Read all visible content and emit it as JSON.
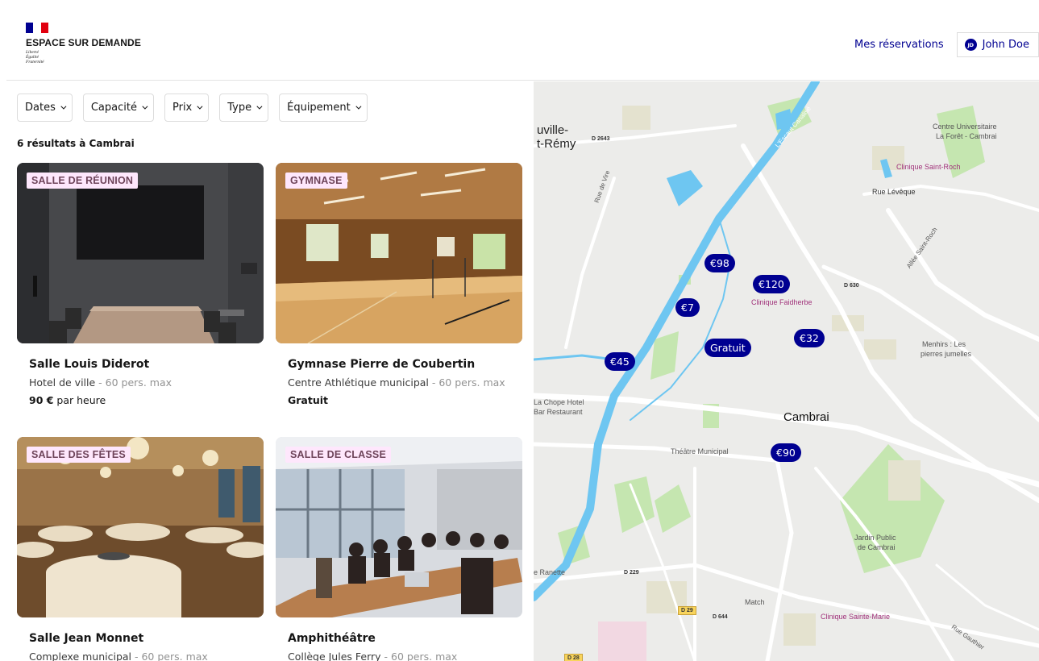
{
  "header": {
    "brand_title": "ESPACE SUR DEMANDE",
    "motto": [
      "Liberté",
      "Égalité",
      "Fraternité"
    ],
    "nav_reservations": "Mes réservations",
    "user_initials": "JD",
    "user_name": "John Doe"
  },
  "filters": [
    {
      "label": "Dates"
    },
    {
      "label": "Capacité"
    },
    {
      "label": "Prix"
    },
    {
      "label": "Type"
    },
    {
      "label": "Équipement"
    }
  ],
  "results_count": "6 résultats à Cambrai",
  "cards": [
    {
      "badge": "SALLE DE RÉUNION",
      "name": "Salle Louis Diderot",
      "place": "Hotel de ville",
      "capacity": " - 60 pers. max",
      "price_bold": "90 €",
      "price_rest": " par heure"
    },
    {
      "badge": "GYMNASE",
      "name": "Gymnase Pierre de Coubertin",
      "place": "Centre Athlétique municipal",
      "capacity": " - 60 pers. max",
      "price_bold": "Gratuit",
      "price_rest": ""
    },
    {
      "badge": "SALLE DES FÊTES",
      "name": "Salle Jean Monnet",
      "place": "Complexe municipal",
      "capacity": " - 60 pers. max",
      "price_bold": "",
      "price_rest": ""
    },
    {
      "badge": "SALLE DE CLASSE",
      "name": "Amphithéâtre",
      "place": "Collège Jules Ferry",
      "capacity": " - 60 pers. max",
      "price_bold": "",
      "price_rest": ""
    }
  ],
  "map": {
    "pins": [
      "€98",
      "€120",
      "€7",
      "€32",
      "Gratuit",
      "€45",
      "€90"
    ],
    "labels": {
      "town_nw_1": "uville-",
      "town_nw_2": "t-Rémy",
      "d2643": "D 2643",
      "rue_vire": "Rue de Vire",
      "escaut": "L'Escaut Canalisé",
      "cu_1": "Centre Universitaire",
      "cu_2": "La Forêt - Cambrai",
      "clinique_roch": "Clinique Saint-Roch",
      "rue_leveque": "Rue Lévêque",
      "allee_roch": "Allée Saint-Roch",
      "d630": "D 630",
      "clinique_faidherbe": "Clinique Faidherbe",
      "menhirs_1": "Menhirs : Les",
      "menhirs_2": "pierres jumelles",
      "chope_1": "La Chope Hotel",
      "chope_2": "Bar Restaurant",
      "cambrai": "Cambrai",
      "theatre": "Théâtre Municipal",
      "jardin_1": "Jardin Public",
      "jardin_2": "de Cambrai",
      "ranette": "e Ranette",
      "d229": "D 229",
      "match": "Match",
      "d29": "D 29",
      "d644": "D 644",
      "clinique_marie": "Clinique Sainte-Marie",
      "rue_gauthier": "Rue Gauthier",
      "d28": "D 28"
    }
  },
  "colors": {
    "primary": "#000091",
    "badge_bg": "#fee7fc",
    "badge_text": "#6e445a",
    "map_water": "#6ec6f1",
    "map_park": "#c5e6b0"
  }
}
